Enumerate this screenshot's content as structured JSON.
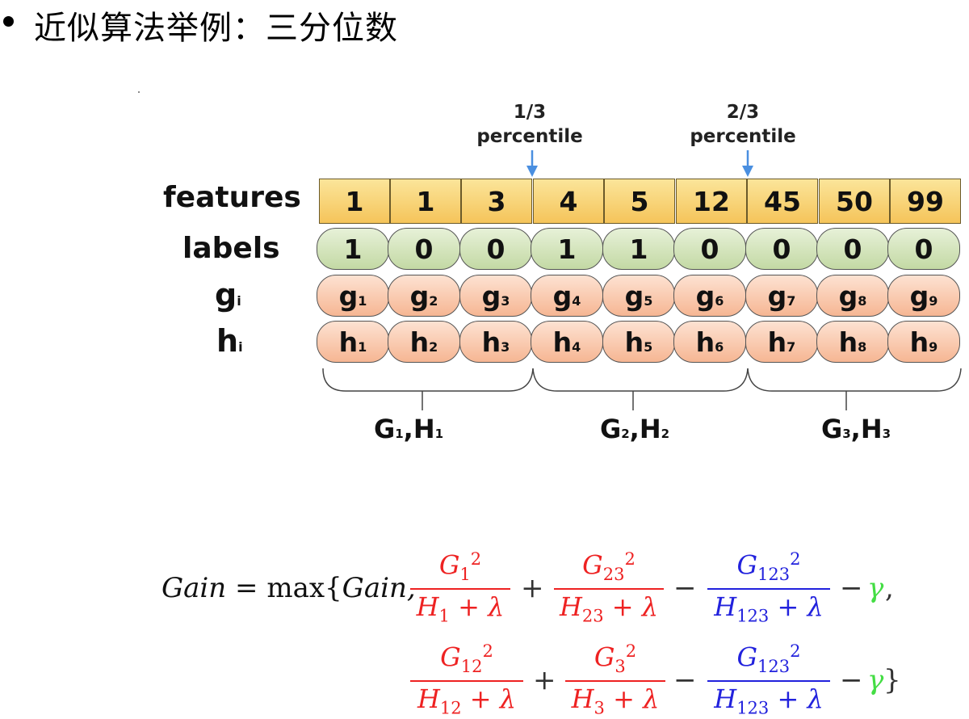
{
  "header": {
    "title": "近似算法举例：三分位数"
  },
  "percentiles": [
    {
      "line1": "1/3",
      "line2": "percentile"
    },
    {
      "line1": "2/3",
      "line2": "percentile"
    }
  ],
  "row_labels": {
    "features": "features",
    "labels": "labels",
    "g": "g",
    "g_sub": "i",
    "h": "h",
    "h_sub": "i"
  },
  "features": [
    "1",
    "1",
    "3",
    "4",
    "5",
    "12",
    "45",
    "50",
    "99"
  ],
  "labels": [
    "1",
    "0",
    "0",
    "1",
    "1",
    "0",
    "0",
    "0",
    "0"
  ],
  "g_cells": [
    {
      "base": "g",
      "sub": "1"
    },
    {
      "base": "g",
      "sub": "2"
    },
    {
      "base": "g",
      "sub": "3"
    },
    {
      "base": "g",
      "sub": "4"
    },
    {
      "base": "g",
      "sub": "5"
    },
    {
      "base": "g",
      "sub": "6"
    },
    {
      "base": "g",
      "sub": "7"
    },
    {
      "base": "g",
      "sub": "8"
    },
    {
      "base": "g",
      "sub": "9"
    }
  ],
  "h_cells": [
    {
      "base": "h",
      "sub": "1"
    },
    {
      "base": "h",
      "sub": "2"
    },
    {
      "base": "h",
      "sub": "3"
    },
    {
      "base": "h",
      "sub": "4"
    },
    {
      "base": "h",
      "sub": "5"
    },
    {
      "base": "h",
      "sub": "6"
    },
    {
      "base": "h",
      "sub": "7"
    },
    {
      "base": "h",
      "sub": "8"
    },
    {
      "base": "h",
      "sub": "9"
    }
  ],
  "groups": [
    {
      "g": "G",
      "g_sub": "1",
      "sep": ",",
      "h": "H",
      "h_sub": "1"
    },
    {
      "g": "G",
      "g_sub": "2",
      "sep": ",",
      "h": "H",
      "h_sub": "2"
    },
    {
      "g": "G",
      "g_sub": "3",
      "sep": ",",
      "h": "H",
      "h_sub": "3"
    }
  ],
  "formula": {
    "lhs": "Gain",
    "equals": "=",
    "max": "max{",
    "gain_arg": "Gain,",
    "close": "}",
    "plus": "+",
    "minus": "−",
    "comma": ",",
    "gamma": "γ",
    "G": "G",
    "H": "H",
    "lambda": "λ",
    "sq": "2",
    "line1": {
      "t1_num_sub": "1",
      "t1_den_sub": "1",
      "t2_num_sub": "23",
      "t2_den_sub": "23",
      "t3_num_sub": "123",
      "t3_den_sub": "123"
    },
    "line2": {
      "t1_num_sub": "12",
      "t1_den_sub": "12",
      "t2_num_sub": "3",
      "t2_den_sub": "3",
      "t3_num_sub": "123",
      "t3_den_sub": "123"
    }
  },
  "colors": {
    "feature_fill": "#f7cf6a",
    "label_fill": "#d3e5bb",
    "gh_fill": "#f9c9ad",
    "arrow": "#4a8fe0",
    "red_term": "#ee2222",
    "blue_term": "#2222dd",
    "gamma": "#44dd44"
  }
}
